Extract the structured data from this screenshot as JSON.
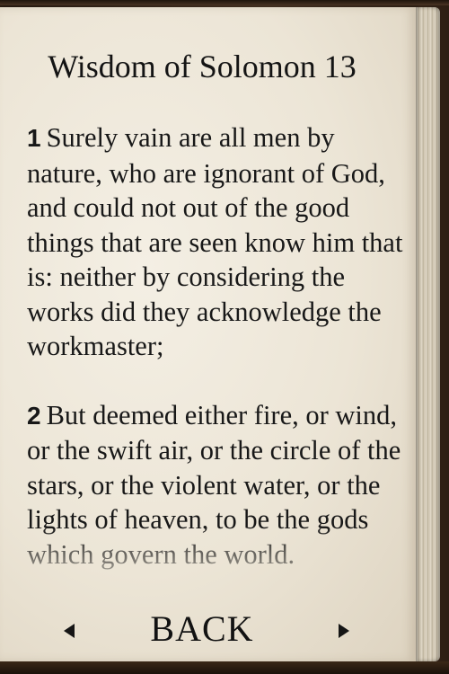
{
  "chapter": {
    "title": "Wisdom of Solomon 13"
  },
  "verses": [
    {
      "number": "1",
      "text": "Surely vain are all men by nature, who are ignorant of God, and could not out of the good things that are seen know him that is: neither by considering the works did they acknowledge the workmaster;"
    },
    {
      "number": "2",
      "text": "But deemed either fire, or wind, or the swift air, or the circle of the stars, or the violent water, or the lights of heaven, to be the gods which govern the world."
    }
  ],
  "navigation": {
    "back_label": "BACK",
    "prev_icon": "triangle-left-icon",
    "next_icon": "triangle-right-icon"
  },
  "colors": {
    "page": "#ece5d6",
    "text": "#181818",
    "binding": "#3a2818"
  }
}
